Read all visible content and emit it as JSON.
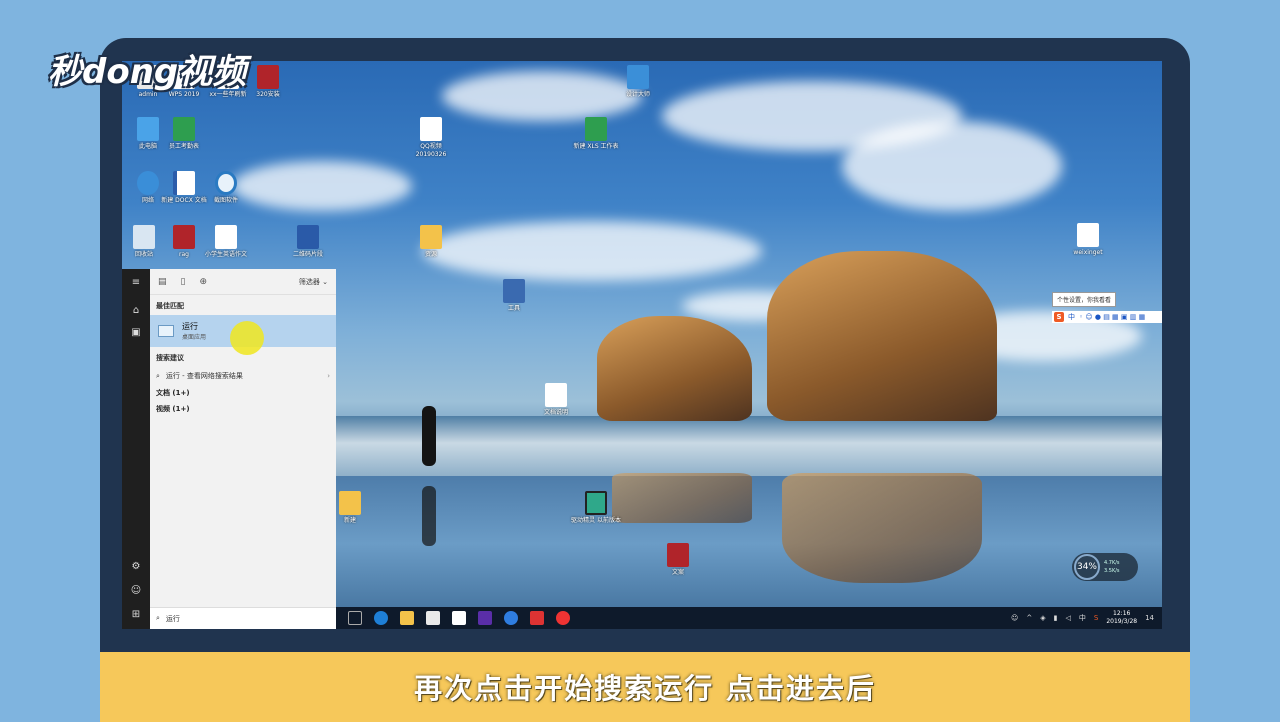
{
  "logo": {
    "text": "秒dong视频"
  },
  "subtitle": "再次点击开始搜索运行 点击进去后",
  "desktop": {
    "icons": [
      {
        "name": "admin",
        "label": "admin",
        "color": "#e8e8e8"
      },
      {
        "name": "wps",
        "label": "WPS 2019",
        "color": "#ffffff"
      },
      {
        "name": "doc-ytu",
        "label": "xx一些年刷新",
        "color": "#ffffff"
      },
      {
        "name": "winrar-top",
        "label": "320安装",
        "color": "#b0242a"
      },
      {
        "name": "computer",
        "label": "此电脑",
        "color": "#4aa3e8"
      },
      {
        "name": "sheet1",
        "label": "员工考勤表",
        "color": "#2e9e4f"
      },
      {
        "name": "net",
        "label": "网络",
        "color": "#3a8ed8"
      },
      {
        "name": "doc-word",
        "label": "新建 DOCX 文档",
        "color": "#2b5caa"
      },
      {
        "name": "app-circle",
        "label": "截图软件",
        "color": "#e8f2fa"
      },
      {
        "name": "recycle",
        "label": "回收站",
        "color": "#d9e6f2"
      },
      {
        "name": "winrar2",
        "label": "rag",
        "color": "#b0242a"
      },
      {
        "name": "doc3",
        "label": "小学生英语作文",
        "color": "#ffffff"
      },
      {
        "name": "video",
        "label": "二维码片段",
        "color": "#2a5aa8"
      },
      {
        "name": "qqvideo",
        "label": "QQ视频 20190326",
        "color": "#ffffff"
      },
      {
        "name": "sheet2",
        "label": "新建 XLS 工作表",
        "color": "#2e9e4f"
      },
      {
        "name": "folder1",
        "label": "资源",
        "color": "#f3c24a"
      },
      {
        "name": "tool1",
        "label": "工具",
        "color": "#3a6ab0"
      },
      {
        "name": "app-top",
        "label": "设计大师",
        "color": "#3b8fd8"
      },
      {
        "name": "phone",
        "label": "weixinget",
        "color": "#ffffff"
      },
      {
        "name": "doc4",
        "label": "文档说明",
        "color": "#ffffff"
      },
      {
        "name": "folder2",
        "label": "新建",
        "color": "#f3c24a"
      },
      {
        "name": "monitor",
        "label": "驱动精灵 以前版本",
        "color": "#2fa88a"
      },
      {
        "name": "winrar3",
        "label": "文案",
        "color": "#b0242a"
      }
    ]
  },
  "startmenu": {
    "filter_label": "筛选器",
    "best_match_header": "最佳匹配",
    "best_match_title": "运行",
    "best_match_sub": "桌面应用",
    "search_suggest_header": "搜索建议",
    "suggestion": "运行 - 查看网络搜索结果",
    "documents": "文档 (1+)",
    "videos": "视频 (1+)",
    "search_value": "运行"
  },
  "ime": {
    "tooltip": "个性设置，你我看看",
    "label": "中"
  },
  "speed": {
    "percent": "34%",
    "up": "4.7K/s",
    "down": "3.5K/s"
  },
  "taskbar": {
    "time": "12:16",
    "date": "2019/3/28",
    "lang": "中",
    "notif_count": "14"
  }
}
